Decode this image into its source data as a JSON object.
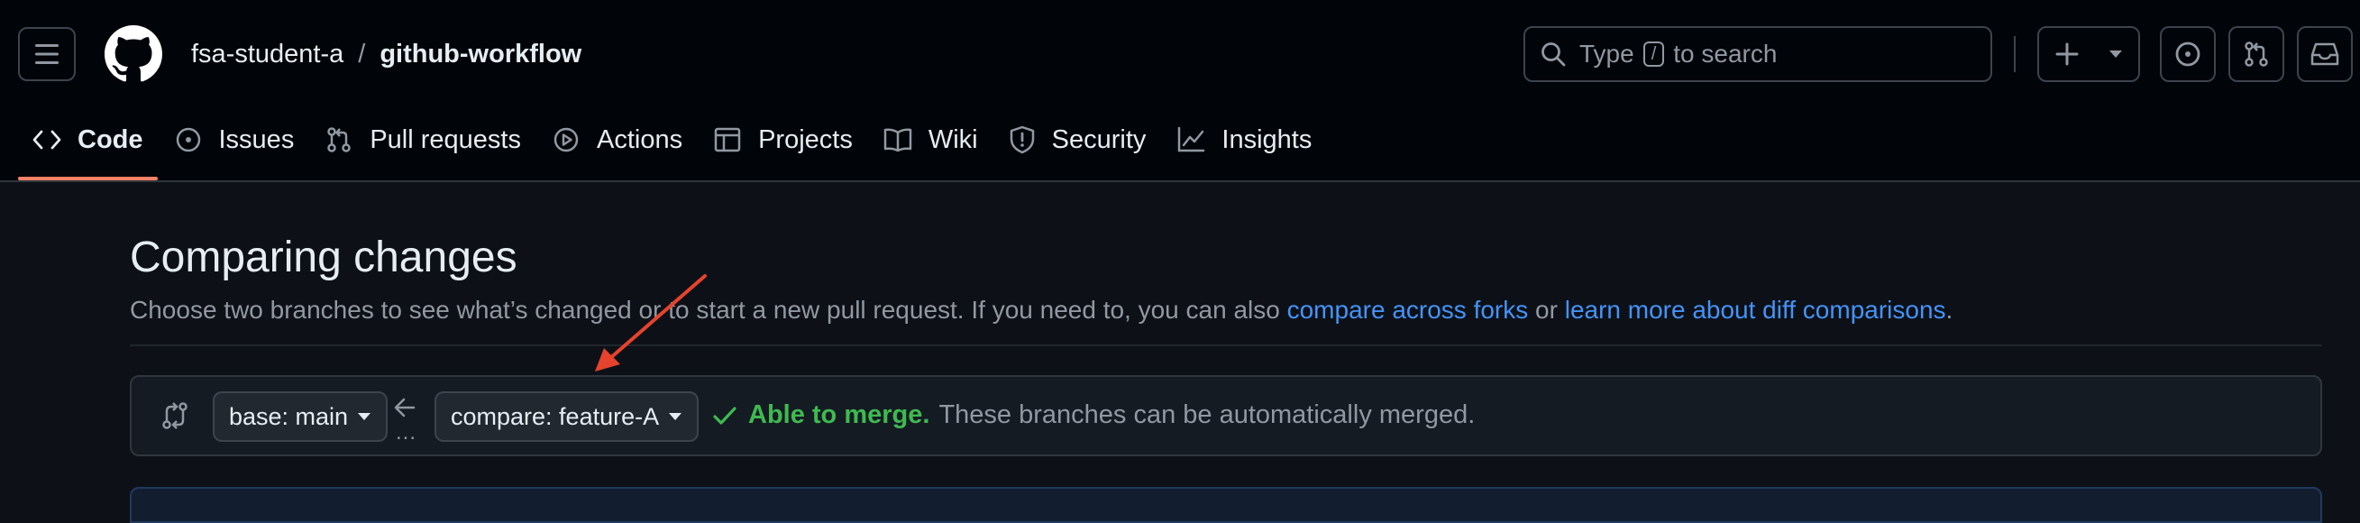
{
  "header": {
    "owner": "fsa-student-a",
    "separator": "/",
    "repo": "github-workflow",
    "search": {
      "prefix": "Type",
      "key": "/",
      "suffix": "to search"
    },
    "plus_label": "+"
  },
  "nav": {
    "tabs": [
      {
        "label": "Code",
        "icon": "code-icon",
        "selected": true
      },
      {
        "label": "Issues",
        "icon": "issue-opened-icon"
      },
      {
        "label": "Pull requests",
        "icon": "git-pull-request-icon"
      },
      {
        "label": "Actions",
        "icon": "play-icon"
      },
      {
        "label": "Projects",
        "icon": "table-icon"
      },
      {
        "label": "Wiki",
        "icon": "book-icon"
      },
      {
        "label": "Security",
        "icon": "shield-icon"
      },
      {
        "label": "Insights",
        "icon": "graph-icon"
      }
    ]
  },
  "main": {
    "title": "Comparing changes",
    "subtitle": {
      "text": "Choose two branches to see what’s changed or to start a new pull request. If you need to, you can also",
      "link1": "compare across forks",
      "middle": "or",
      "link2": "learn more about diff comparisons",
      "end": "."
    },
    "compare": {
      "base_label": "base: main",
      "compare_label": "compare: feature-A",
      "dots": "...",
      "status_title": "Able to merge.",
      "status_text": "These branches can be automatically merged."
    }
  },
  "colors": {
    "background": "#0d1117",
    "header_bg": "#010409",
    "accent_tab": "#f78166",
    "link": "#4493f8",
    "success": "#3fb950",
    "annotation_arrow": "#e5432d"
  }
}
